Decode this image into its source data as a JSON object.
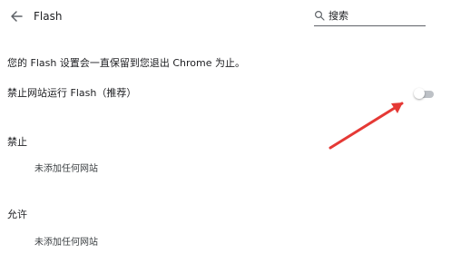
{
  "header": {
    "back_icon": "arrow-back-icon",
    "title": "Flash",
    "search": {
      "icon": "search-icon",
      "placeholder": "搜索",
      "value": ""
    }
  },
  "main": {
    "description": "您的 Flash 设置会一直保留到您退出 Chrome 为止。",
    "setting": {
      "label": "禁止网站运行 Flash（推荐）",
      "toggle_state": "off"
    },
    "sections": [
      {
        "title": "禁止",
        "empty_text": "未添加任何网站"
      },
      {
        "title": "允许",
        "empty_text": "未添加任何网站"
      }
    ]
  },
  "annotation": {
    "shape": "arrow",
    "color": "#e53935"
  },
  "colors": {
    "text": "#202124",
    "toggle_track": "#bdc1c6",
    "search_underline": "#5f6368"
  }
}
